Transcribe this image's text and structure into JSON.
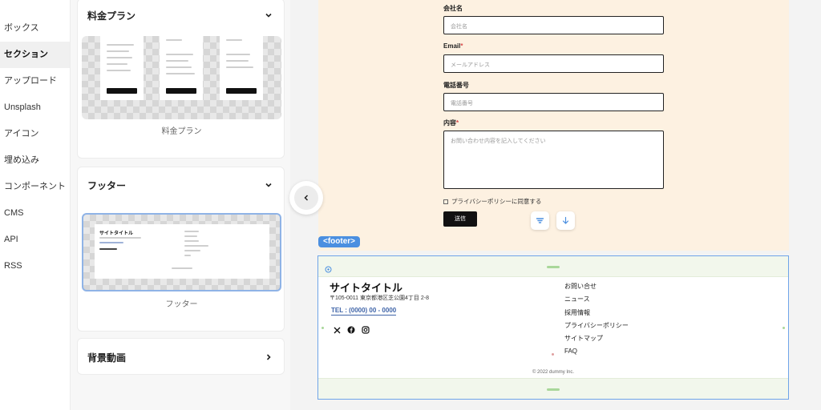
{
  "nav": {
    "items": [
      {
        "label": "ボックス",
        "active": false
      },
      {
        "label": "セクション",
        "active": true
      },
      {
        "label": "アップロード",
        "active": false
      },
      {
        "label": "Unsplash",
        "active": false
      },
      {
        "label": "アイコン",
        "active": false
      },
      {
        "label": "埋め込み",
        "active": false
      },
      {
        "label": "コンポーネント",
        "active": false
      },
      {
        "label": "CMS",
        "active": false
      },
      {
        "label": "API",
        "active": false
      },
      {
        "label": "RSS",
        "active": false
      }
    ]
  },
  "panel": {
    "pricing": {
      "title": "料金プラン",
      "caption": "料金プラン"
    },
    "footer": {
      "title": "フッター",
      "caption": "フッター"
    },
    "bgvideo": {
      "title": "背景動画"
    }
  },
  "form": {
    "company_label": "会社名",
    "company_placeholder": "会社名",
    "email_label": "Email",
    "email_required": "*",
    "email_placeholder": "メールアドレス",
    "phone_label": "電話番号",
    "phone_placeholder": "電話番号",
    "content_label": "内容",
    "content_required": "*",
    "content_placeholder": "お問い合わせ内容を記入してください",
    "privacy_label": "プライバシーポリシーに同意する",
    "submit_label": "送信"
  },
  "footer_tag": "<footer>",
  "footer": {
    "site_title": "サイトタイトル",
    "address": "〒105-0011 東京都港区芝公園4丁目 2-8",
    "tel": "TEL : (0000) 00 - 0000",
    "links": [
      "お問い合せ",
      "ニュース",
      "採用情報",
      "プライバシーポリシー",
      "サイトマップ",
      "FAQ"
    ],
    "copyright": "© 2022 dummy Inc."
  },
  "colors": {
    "accent": "#4b8fe0",
    "form_bg": "#fdf1e1",
    "tel": "#3f64a8",
    "padding_band": "#f2f7ec"
  }
}
